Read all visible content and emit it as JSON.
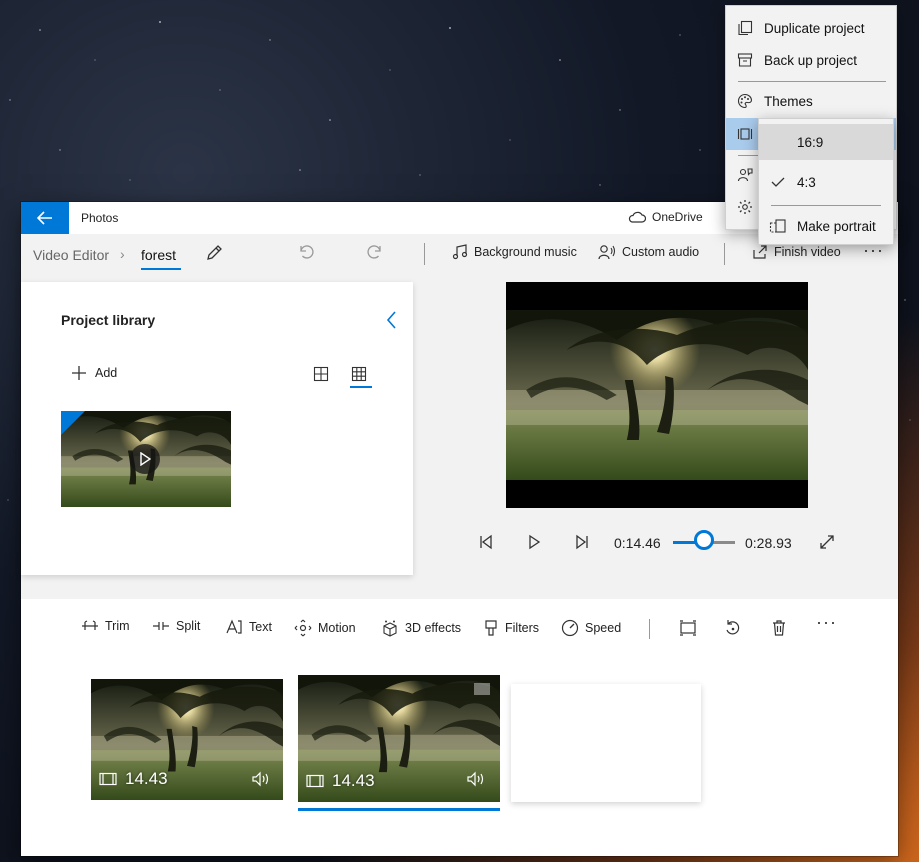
{
  "window": {
    "app_title": "Photos",
    "onedrive_label": "OneDrive",
    "accent": "#0078d7"
  },
  "breadcrumb": {
    "root": "Video Editor",
    "current": "forest"
  },
  "commandbar": {
    "background_music": "Background music",
    "custom_audio": "Custom audio",
    "finish_video": "Finish video"
  },
  "library": {
    "title": "Project library",
    "add_label": "Add"
  },
  "playback": {
    "current_time": "0:14.46",
    "total_time": "0:28.93",
    "progress": 0.5
  },
  "toolbar": {
    "trim": "Trim",
    "split": "Split",
    "text": "Text",
    "motion": "Motion",
    "effects_3d": "3D effects",
    "filters": "Filters",
    "speed": "Speed"
  },
  "storyboard": {
    "clips": [
      {
        "duration": "14.43",
        "selected": false
      },
      {
        "duration": "14.43",
        "selected": true
      }
    ]
  },
  "menu": {
    "items": [
      {
        "label": "Duplicate project",
        "icon": "duplicate-icon"
      },
      {
        "label": "Back up project",
        "icon": "archive-icon"
      },
      {
        "label": "Themes",
        "icon": "palette-icon"
      }
    ]
  },
  "aspect_submenu": {
    "options": [
      {
        "label": "16:9",
        "checked": false,
        "highlighted": true
      },
      {
        "label": "4:3",
        "checked": true,
        "highlighted": false
      }
    ],
    "make_portrait": "Make portrait"
  }
}
